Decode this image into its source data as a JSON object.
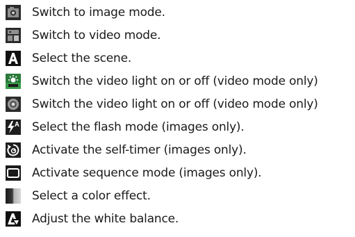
{
  "items": [
    {
      "icon": "camera-image-mode-icon",
      "label": "Switch to image mode."
    },
    {
      "icon": "video-mode-icon",
      "label": "Switch to video mode."
    },
    {
      "icon": "scene-icon",
      "label": "Select the scene."
    },
    {
      "icon": "video-light-icon",
      "label": "Switch the video light on or off (video mode only)"
    },
    {
      "icon": "video-light-round-icon",
      "label": "Switch the video light on or off (video mode only)"
    },
    {
      "icon": "flash-auto-icon",
      "label": "Select the flash mode (images only)."
    },
    {
      "icon": "self-timer-icon",
      "label": "Activate the self-timer (images only)."
    },
    {
      "icon": "sequence-mode-icon",
      "label": "Activate sequence mode (images only)."
    },
    {
      "icon": "color-effect-icon",
      "label": "Select a color effect."
    },
    {
      "icon": "white-balance-icon",
      "label": "Adjust the white balance."
    }
  ]
}
